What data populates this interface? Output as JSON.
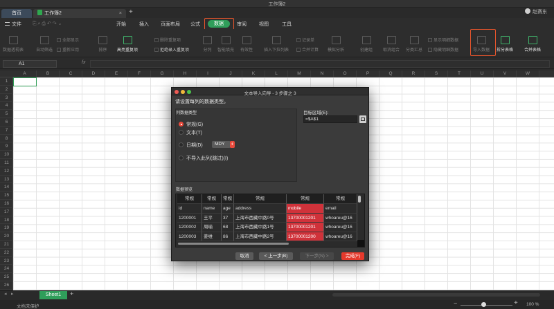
{
  "window": {
    "title": "工作簿2"
  },
  "tabs": {
    "home": "首页",
    "doc": "工作簿2",
    "add": "+",
    "close": "×"
  },
  "user": {
    "name": "赵赛东"
  },
  "menu": {
    "file": "文件",
    "items": [
      "开始",
      "插入",
      "页面布局",
      "公式",
      "数据",
      "审阅",
      "视图",
      "工具"
    ]
  },
  "toolbar": {
    "pivot": "数据透视表",
    "autofilter": "自动筛选",
    "showall": "全部显示",
    "reapply": "重新应用",
    "sort": "排序",
    "highlight_dup": "高亮重复项",
    "delete_dup": "删除重复项",
    "reject_dup": "拒绝录入重复项",
    "split": "分列",
    "fill": "智能填充",
    "validate": "有效性",
    "dropdown": "插入下拉列表",
    "record": "记录单",
    "consolidate": "合并计算",
    "simulate": "模拟分析",
    "create_group": "创建组",
    "cancel_group": "取消组合",
    "subtotal": "分类汇总",
    "show_detail": "显示明细数据",
    "hide_detail": "隐藏明细数据",
    "import": "导入数据",
    "split_table": "拆分表格",
    "merge_table": "合并表格"
  },
  "formula": {
    "cell": "A1",
    "fx": "fx"
  },
  "grid": {
    "columns": [
      "A",
      "B",
      "C",
      "D",
      "E",
      "F",
      "G",
      "H",
      "I",
      "J",
      "K",
      "L",
      "M",
      "N",
      "O",
      "P",
      "Q",
      "R",
      "S",
      "T",
      "U",
      "V",
      "W"
    ],
    "rows": [
      "1",
      "2",
      "3",
      "4",
      "5",
      "6",
      "7",
      "8",
      "9",
      "10",
      "11",
      "12",
      "13",
      "14",
      "15",
      "16",
      "17",
      "18",
      "19",
      "20",
      "21",
      "22",
      "23",
      "24",
      "25",
      "26"
    ]
  },
  "sheets": {
    "active": "Sheet1",
    "add": "+",
    "nav": [
      "◂",
      "▸"
    ]
  },
  "status": {
    "text": "文档未保护",
    "zoom_minus": "−",
    "zoom_plus": "+",
    "zoom": "100 %",
    "zoom_fraction": 0.44
  },
  "dialog": {
    "title": "文本导入向导 - 3 步骤之 3",
    "subtitle": "请设置每列的数据类型。",
    "group_label": "列数据类型",
    "options": {
      "general": "常规(G)",
      "text": "文本(T)",
      "date": "日期(D)",
      "skip": "不导入此列(跳过)(I)"
    },
    "date_format": "MDY",
    "dest_label": "目标区域(E):",
    "dest_value": "=$A$1",
    "preview_label": "数据预览",
    "preview": {
      "types": [
        "常规",
        "常规",
        "常规",
        "常规",
        "常规",
        "常规"
      ],
      "rows": [
        [
          "id",
          "name",
          "age",
          "address",
          "mobile",
          "email"
        ],
        [
          "1200001",
          "王平",
          "37",
          "上海市西藏中路0号",
          "13700001201",
          "whoareu@16"
        ],
        [
          "1200002",
          "周瑜",
          "68",
          "上海市西藏中路1号",
          "13700001201",
          "whoareu@16"
        ],
        [
          "1200003",
          "姜维",
          "86",
          "上海市西藏中路2号",
          "13700001200",
          "whoareu@16"
        ]
      ]
    },
    "buttons": {
      "cancel": "取消",
      "back": "< 上一步(B)",
      "next": "下一步(N) >",
      "finish": "完成(F)"
    }
  }
}
